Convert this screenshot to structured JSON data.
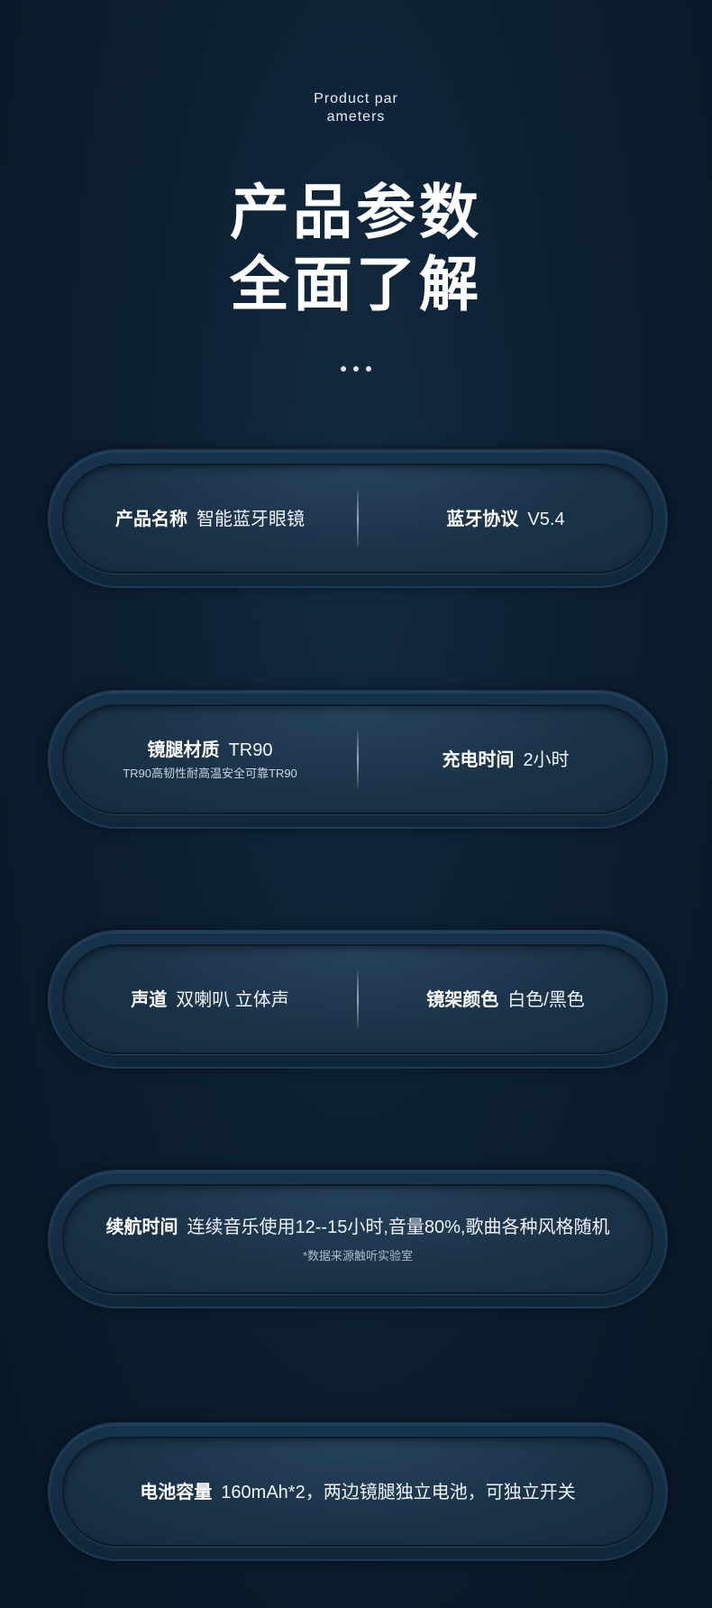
{
  "header": {
    "subtitle_line1": "Product par",
    "subtitle_line2": "ameters",
    "title_line1": "产品参数",
    "title_line2": "全面了解"
  },
  "params": {
    "product_name_label": "产品名称",
    "product_name_value": "智能蓝牙眼镜",
    "bluetooth_label": "蓝牙协议",
    "bluetooth_value": "V5.4",
    "temple_label": "镜腿材质",
    "temple_value": "TR90",
    "temple_note": "TR90高韧性耐高温安全可靠TR90",
    "charge_label": "充电时间",
    "charge_value": "2小时",
    "channel_label": "声道",
    "channel_value": "双喇叭 立体声",
    "frame_color_label": "镜架颜色",
    "frame_color_value": "白色/黑色",
    "endurance_label": "续航时间",
    "endurance_value": "连续音乐使用12--15小时,音量80%,歌曲各种风格随机",
    "endurance_note": "*数据来源触听实验室",
    "battery_label": "电池容量",
    "battery_value": "160mAh*2，两边镜腿独立电池，可独立开关"
  }
}
